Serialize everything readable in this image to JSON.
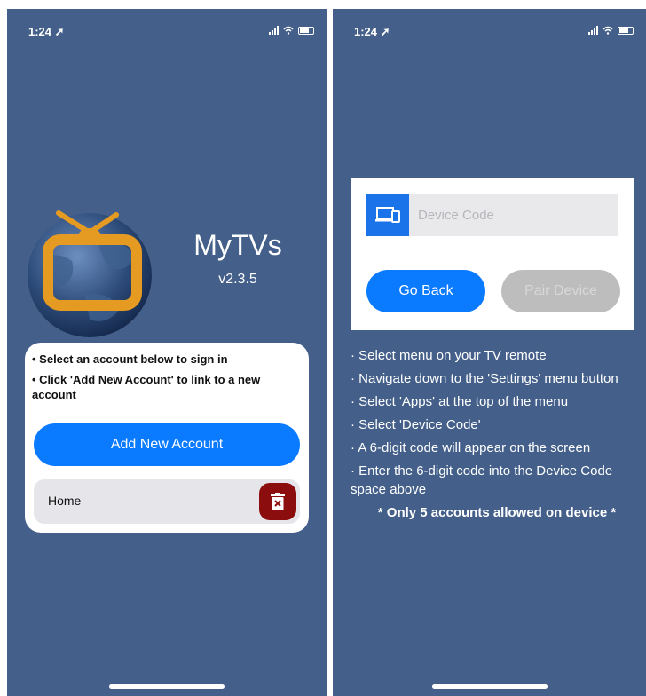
{
  "status_bar": {
    "time": "1:24"
  },
  "login_screen": {
    "app_name": "MyTVs",
    "version": "v2.3.5",
    "instructions": [
      "• Select an account below to sign in",
      "• Click 'Add New Account' to link to a new account"
    ],
    "add_account_label": "Add New Account",
    "accounts": [
      {
        "name": "Home"
      }
    ]
  },
  "pair_screen": {
    "device_code_placeholder": "Device Code",
    "device_code_value": "",
    "go_back_label": "Go Back",
    "pair_device_label": "Pair Device",
    "steps": [
      "· Select menu on your TV remote",
      "· Navigate down to the 'Settings' menu button",
      "· Select 'Apps' at the top of the menu",
      "· Select 'Device Code'",
      "· A 6-digit code will appear on the screen",
      "· Enter the 6-digit code into the Device Code space above"
    ],
    "note": "* Only 5 accounts allowed on device *"
  },
  "colors": {
    "background": "#44608a",
    "accent": "#0a7aff",
    "delete": "#8b0d0d",
    "disabled": "#bdbdbd",
    "logo_frame": "#e59a22"
  },
  "icons": {
    "status": [
      "location-arrow-icon",
      "signal-icon",
      "wifi-icon",
      "battery-icon"
    ],
    "logo": "tv-globe-logo",
    "delete": "trash-icon",
    "device_code": "devices-icon"
  }
}
